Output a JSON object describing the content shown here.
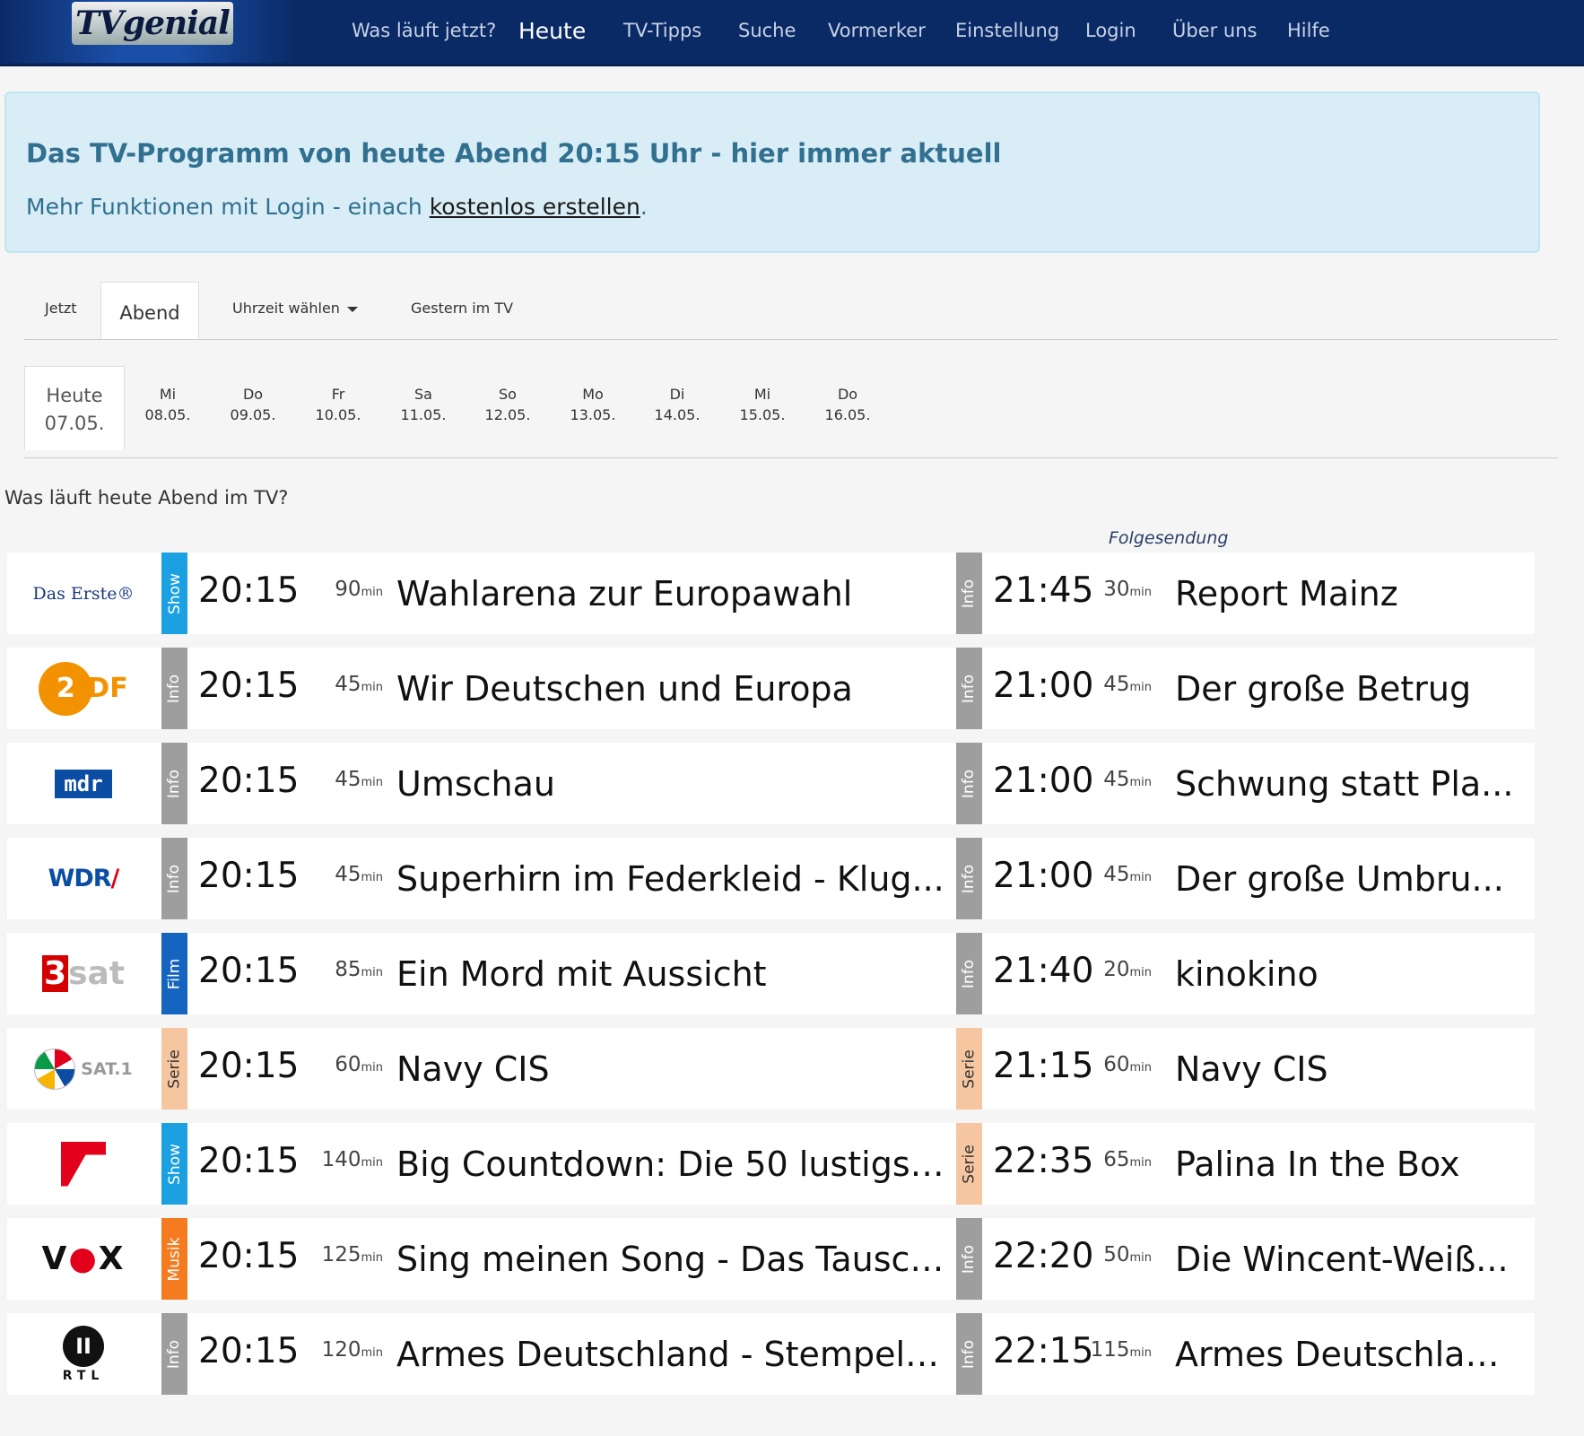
{
  "app": {
    "logo_text": "TVgenial"
  },
  "nav": {
    "items": [
      {
        "label": "Was läuft jetzt?"
      },
      {
        "label": "Heute"
      },
      {
        "label": "TV-Tipps"
      },
      {
        "label": "Suche"
      },
      {
        "label": "Vormerker"
      },
      {
        "label": "Einstellung"
      },
      {
        "label": "Login"
      },
      {
        "label": "Über uns"
      },
      {
        "label": "Hilfe"
      }
    ],
    "active_index": 1
  },
  "info": {
    "title": "Das TV-Programm von heute Abend 20:15 Uhr - hier immer aktuell",
    "sub_prefix": "Mehr Funktionen mit Login - einach ",
    "sub_link": "kostenlos erstellen",
    "sub_suffix": "."
  },
  "tabs": {
    "jetzt": "Jetzt",
    "abend": "Abend",
    "uhrzeit": "Uhrzeit wählen",
    "gestern": "Gestern im TV"
  },
  "days": [
    {
      "day": "Heute",
      "date": "07.05."
    },
    {
      "day": "Mi",
      "date": "08.05."
    },
    {
      "day": "Do",
      "date": "09.05."
    },
    {
      "day": "Fr",
      "date": "10.05."
    },
    {
      "day": "Sa",
      "date": "11.05."
    },
    {
      "day": "So",
      "date": "12.05."
    },
    {
      "day": "Mo",
      "date": "13.05."
    },
    {
      "day": "Di",
      "date": "14.05."
    },
    {
      "day": "Mi",
      "date": "15.05."
    },
    {
      "day": "Do",
      "date": "16.05."
    }
  ],
  "section_heading": "Was läuft heute Abend im TV?",
  "followup_label": "Folgesendung",
  "duration_unit": "min",
  "genre_colors": {
    "Show": "#1ba1e2",
    "Info": "#9e9e9e",
    "Film": "#1565c0",
    "Serie": "#f5c6a0",
    "Musik": "#f47b20"
  },
  "logos": {
    "daserste": "Das Erste®",
    "zdf_2": "2",
    "zdf_df": "DF",
    "mdr": "mdr",
    "wdr": "WDR",
    "wdr_slash": "/",
    "sat3_num": "3",
    "sat3_text": "sat",
    "sat1": "SAT.1",
    "vox_v": "V",
    "vox_o": "●",
    "vox_x": "X",
    "rtl2_num": "II",
    "rtl2_text": "RTL"
  },
  "rows": [
    {
      "channel": "Das Erste",
      "g1": "Show",
      "t1": "20:15",
      "d1": "90",
      "title1": "Wahlarena zur Europawahl",
      "g2": "Info",
      "t2": "21:45",
      "d2": "30",
      "title2": "Report Mainz"
    },
    {
      "channel": "ZDF",
      "g1": "Info",
      "t1": "20:15",
      "d1": "45",
      "title1": "Wir Deutschen und Europa",
      "g2": "Info",
      "t2": "21:00",
      "d2": "45",
      "title2": "Der große Betrug"
    },
    {
      "channel": "MDR",
      "g1": "Info",
      "t1": "20:15",
      "d1": "45",
      "title1": "Umschau",
      "g2": "Info",
      "t2": "21:00",
      "d2": "45",
      "title2": "Schwung statt Pla..."
    },
    {
      "channel": "WDR",
      "g1": "Info",
      "t1": "20:15",
      "d1": "45",
      "title1": "Superhirn im Federkleid - Klug...",
      "g2": "Info",
      "t2": "21:00",
      "d2": "45",
      "title2": "Der große Umbru..."
    },
    {
      "channel": "3sat",
      "g1": "Film",
      "t1": "20:15",
      "d1": "85",
      "title1": "Ein Mord mit Aussicht",
      "g2": "Info",
      "t2": "21:40",
      "d2": "20",
      "title2": "kinokino"
    },
    {
      "channel": "SAT.1",
      "g1": "Serie",
      "t1": "20:15",
      "d1": "60",
      "title1": "Navy CIS",
      "g2": "Serie",
      "t2": "21:15",
      "d2": "60",
      "title2": "Navy CIS"
    },
    {
      "channel": "ProSieben",
      "g1": "Show",
      "t1": "20:15",
      "d1": "140",
      "title1": "Big Countdown: Die 50 lustigst...",
      "g2": "Serie",
      "t2": "22:35",
      "d2": "65",
      "title2": "Palina In the Box"
    },
    {
      "channel": "VOX",
      "g1": "Musik",
      "t1": "20:15",
      "d1": "125",
      "title1": "Sing meinen Song - Das Tausch...",
      "g2": "Info",
      "t2": "22:20",
      "d2": "50",
      "title2": "Die Wincent-Weiß..."
    },
    {
      "channel": "RTL II",
      "g1": "Info",
      "t1": "20:15",
      "d1": "120",
      "title1": "Armes Deutschland - Stempeln...",
      "g2": "Info",
      "t2": "22:15",
      "d2": "115",
      "title2": "Armes Deutschlan..."
    }
  ]
}
